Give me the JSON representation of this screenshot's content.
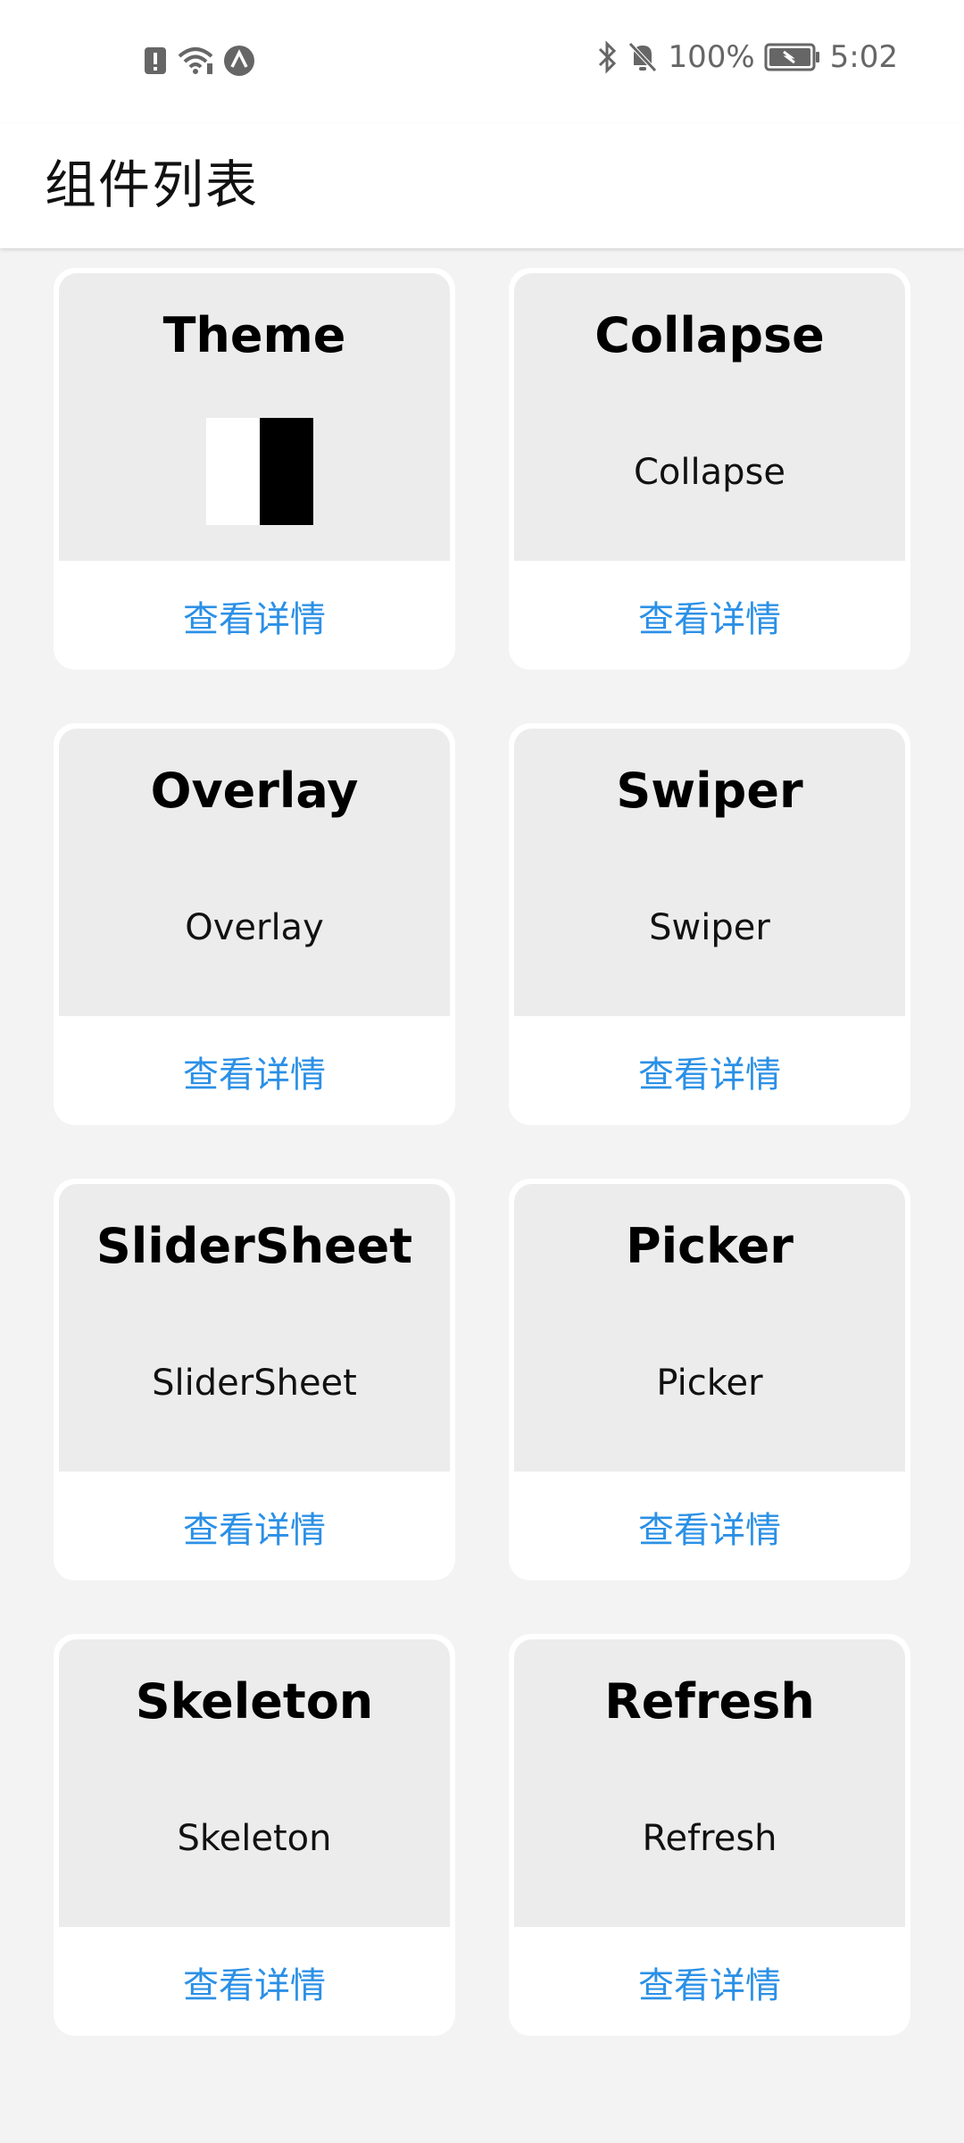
{
  "status_bar": {
    "battery": "100%",
    "time": "5:02",
    "icons": [
      "sim-alert-icon",
      "wifi-icon",
      "sync-icon",
      "bluetooth-icon",
      "mute-icon",
      "battery-icon"
    ]
  },
  "header": {
    "title": "组件列表"
  },
  "cards": [
    {
      "title": "Theme",
      "subtitle": "",
      "link": "查看详情"
    },
    {
      "title": "Collapse",
      "subtitle": "Collapse",
      "link": "查看详情"
    },
    {
      "title": "Overlay",
      "subtitle": "Overlay",
      "link": "查看详情"
    },
    {
      "title": "Swiper",
      "subtitle": "Swiper",
      "link": "查看详情"
    },
    {
      "title": "SliderSheet",
      "subtitle": "SliderSheet",
      "link": "查看详情"
    },
    {
      "title": "Picker",
      "subtitle": "Picker",
      "link": "查看详情"
    },
    {
      "title": "Skeleton",
      "subtitle": "Skeleton",
      "link": "查看详情"
    },
    {
      "title": "Refresh",
      "subtitle": "Refresh",
      "link": "查看详情"
    }
  ],
  "colors": {
    "link": "#2b90e6",
    "background": "#f3f3f3",
    "card_top": "#ececec"
  }
}
